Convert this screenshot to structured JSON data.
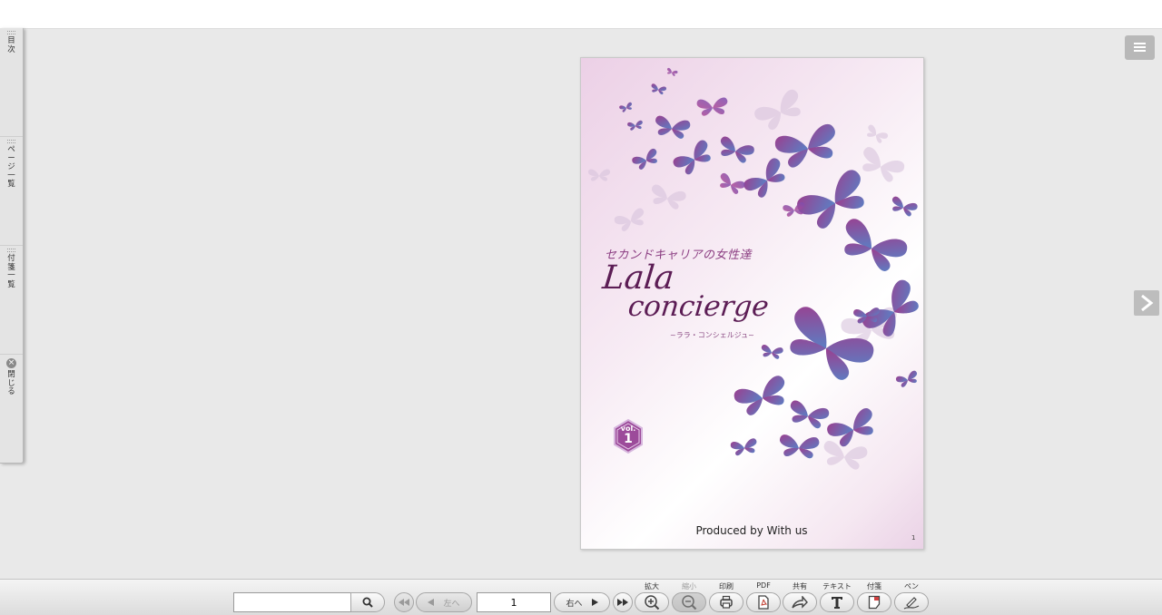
{
  "sidebar": {
    "tabs": [
      {
        "label": "目次"
      },
      {
        "label": "ページ一覧"
      },
      {
        "label": "付箋一覧"
      }
    ],
    "close_label": "閉じる"
  },
  "page": {
    "subtitle": "セカンドキャリアの女性達",
    "title_line1": "Lala",
    "title_line2": "concierge",
    "reading": "~ララ・コンシェルジュ~",
    "vol_label": "vol.",
    "vol_number": "1",
    "produced_by": "Produced by With us",
    "page_number": "1"
  },
  "toolbar": {
    "search": {
      "value": "",
      "placeholder": ""
    },
    "left_label": "左へ",
    "right_label": "右へ",
    "current_page": "1",
    "tools": [
      {
        "label": "拡大",
        "icon": "zoom-in-icon",
        "enabled": true
      },
      {
        "label": "縮小",
        "icon": "zoom-out-icon",
        "enabled": false
      },
      {
        "label": "印刷",
        "icon": "print-icon",
        "enabled": true
      },
      {
        "label": "PDF",
        "icon": "pdf-icon",
        "enabled": true
      },
      {
        "label": "共有",
        "icon": "share-icon",
        "enabled": true
      },
      {
        "label": "テキスト",
        "icon": "text-icon",
        "enabled": true
      },
      {
        "label": "付箋",
        "icon": "sticky-note-icon",
        "enabled": true
      },
      {
        "label": "ペン",
        "icon": "pen-icon",
        "enabled": true
      }
    ]
  },
  "colors": {
    "viewer_bg": "#e9e9e9",
    "title": "#5c1d55",
    "accent_purple": "#8c3f83",
    "butterfly_blue": "#5b7fc4"
  }
}
